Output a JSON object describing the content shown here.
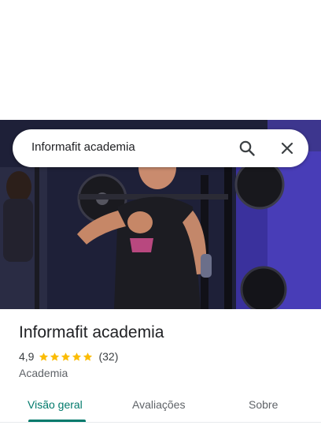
{
  "search": {
    "value": "Informafit academia",
    "icons": {
      "search": "search-icon",
      "close": "close-icon"
    }
  },
  "hero": {
    "image": "photo-gym-man-training-chest-press"
  },
  "place": {
    "title": "Informafit academia",
    "rating": "4,9",
    "stars": 5,
    "review_count": "(32)",
    "category": "Academia"
  },
  "tabs": [
    {
      "label": "Visão geral",
      "active": true
    },
    {
      "label": "Avaliações",
      "active": false
    },
    {
      "label": "Sobre",
      "active": false
    }
  ],
  "colors": {
    "accent": "#00796b",
    "star": "#fbbc04"
  }
}
